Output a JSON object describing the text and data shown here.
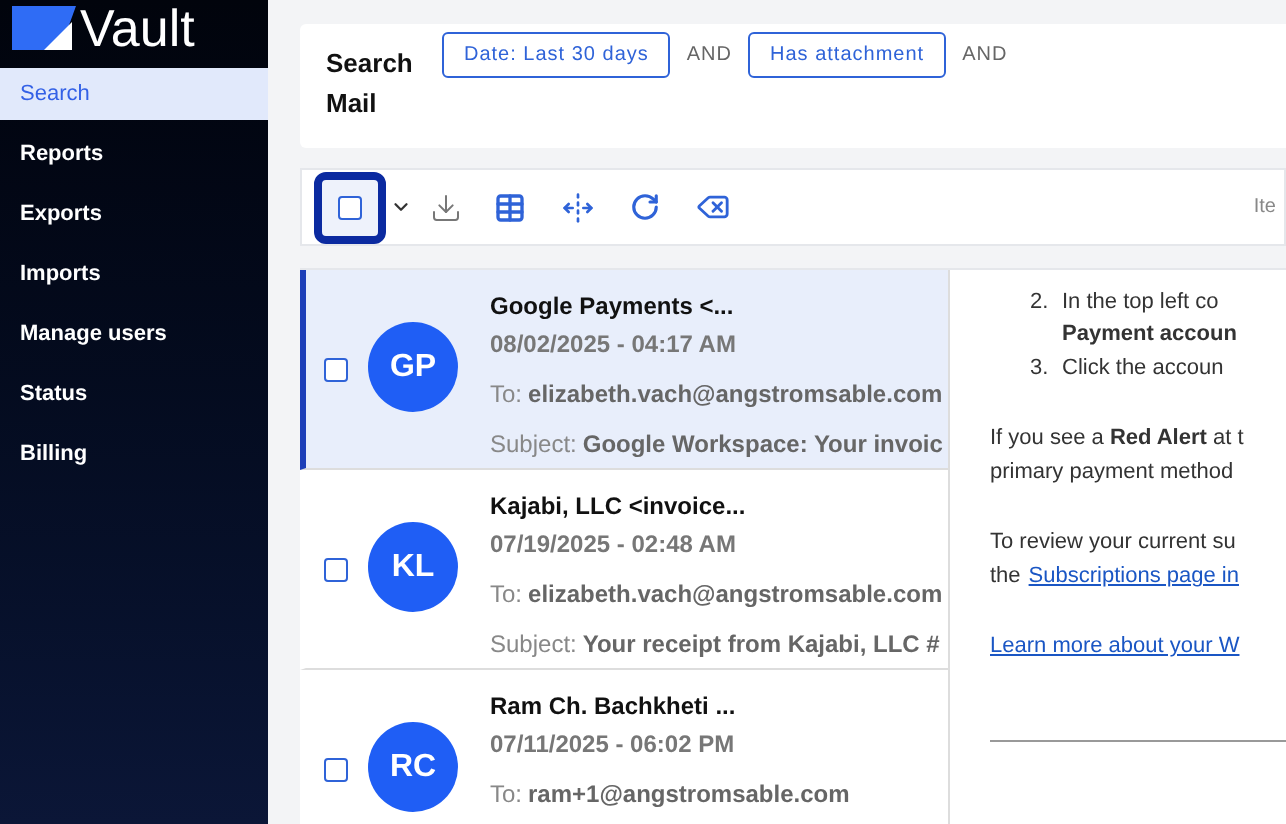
{
  "sidebar": {
    "brand": "Vault",
    "items": [
      {
        "label": "Search",
        "selected": true
      },
      {
        "label": "Reports",
        "selected": false
      },
      {
        "label": "Exports",
        "selected": false
      },
      {
        "label": "Imports",
        "selected": false
      },
      {
        "label": "Manage users",
        "selected": false
      },
      {
        "label": "Status",
        "selected": false
      },
      {
        "label": "Billing",
        "selected": false
      }
    ]
  },
  "search": {
    "title": "Search Mail",
    "filters": [
      {
        "kind": "chip",
        "label": "Date: Last 30 days"
      },
      {
        "kind": "operator",
        "label": "AND"
      },
      {
        "kind": "chip",
        "label": "Has attachment"
      },
      {
        "kind": "operator",
        "label": "AND"
      }
    ]
  },
  "toolbar": {
    "select_all_checked": false,
    "select_all_focused": true,
    "items_label": "Ite"
  },
  "emails": [
    {
      "initials": "GP",
      "sender": "Google Payments <...",
      "date": "08/02/2025 - 04:17 AM",
      "to_label": "To:",
      "to": "elizabeth.vach@angstromsable.com",
      "subject_label": "Subject:",
      "subject": "Google Workspace: Your invoic",
      "selected": true,
      "checked": false
    },
    {
      "initials": "KL",
      "sender": "Kajabi, LLC <invoice...",
      "date": "07/19/2025 - 02:48 AM",
      "to_label": "To:",
      "to": "elizabeth.vach@angstromsable.com",
      "subject_label": "Subject:",
      "subject": "Your receipt from Kajabi, LLC #",
      "selected": false,
      "checked": false
    },
    {
      "initials": "RC",
      "sender": "Ram Ch. Bachkheti ...",
      "date": "07/11/2025 - 06:02 PM",
      "to_label": "To:",
      "to": "ram+1@angstromsable.com",
      "selected": false,
      "checked": false
    }
  ],
  "preview": {
    "list_items": [
      {
        "number": "2.",
        "lines": [
          "In the top left co",
          "**Payment accoun**"
        ]
      },
      {
        "number": "3.",
        "lines": [
          "Click the accoun"
        ]
      }
    ],
    "paragraphs": [
      {
        "lines": [
          [
            {
              "kind": "text",
              "text": "If you see a **Red Alert** at t"
            }
          ],
          [
            {
              "kind": "text",
              "text": "primary payment method"
            }
          ]
        ]
      },
      {
        "lines": [
          [
            {
              "kind": "text",
              "text": "To review your current su"
            }
          ],
          [
            {
              "kind": "text",
              "text": "the"
            },
            {
              "kind": "link",
              "text": "Subscriptions page in"
            }
          ]
        ]
      },
      {
        "lines": [
          [
            {
              "kind": "link",
              "text": "Learn more about your W"
            }
          ]
        ]
      }
    ]
  }
}
